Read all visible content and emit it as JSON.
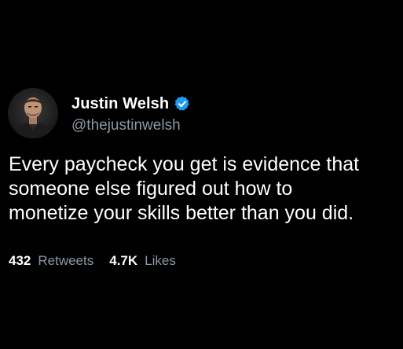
{
  "author": {
    "display_name": "Justin Welsh",
    "handle": "@thejustinwelsh",
    "verified": true,
    "avatar_icon": "profile-photo"
  },
  "tweet": {
    "lines": [
      "Every paycheck you get is evidence that",
      "someone else figured out how to",
      "monetize your skills better than you did."
    ]
  },
  "stats": {
    "retweets_count": "432",
    "retweets_label": "Retweets",
    "likes_count": "4.7K",
    "likes_label": "Likes"
  },
  "colors": {
    "background": "#000000",
    "text": "#ffffff",
    "muted": "#8b98a5",
    "verified_badge": "#1d9bf0"
  }
}
